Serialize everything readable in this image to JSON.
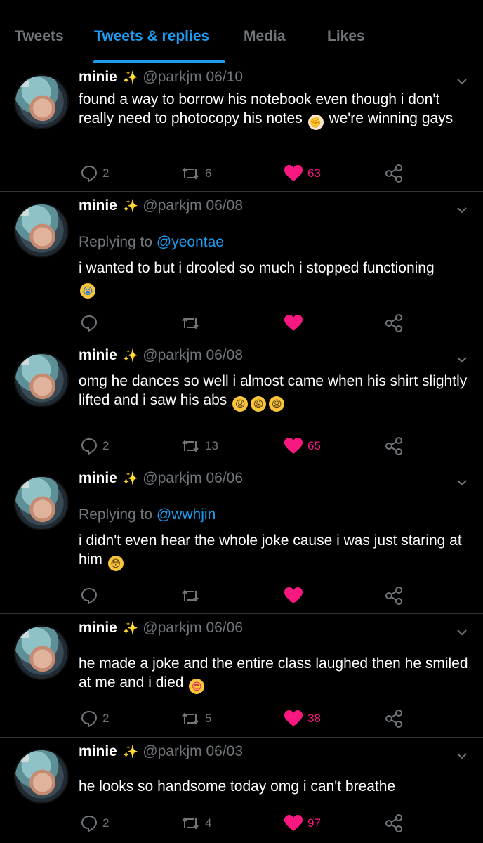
{
  "tabs": [
    {
      "label": "Tweets"
    },
    {
      "label": "Tweets & replies"
    },
    {
      "label": "Media"
    },
    {
      "label": "Likes"
    }
  ],
  "colors": {
    "accent": "#1d9bf0",
    "like": "#f91880",
    "muted": "#71767b",
    "sparkle": "#f5d23a"
  },
  "tweets": [
    {
      "name": "minie",
      "sparkle": "✨",
      "handle": "@parkjm 06/10",
      "replying_label": "",
      "replying_to": "",
      "text": "found a way to borrow his notebook even though i don't really need to photocopy his notes",
      "emoji": "✊",
      "text_after": "we're winning gays",
      "replies": "2",
      "retweets": "6",
      "likes": "63",
      "liked": true
    },
    {
      "name": "minie",
      "sparkle": "✨",
      "handle": "@parkjm 06/08",
      "replying_label": "Replying to",
      "replying_to": "@yeontae",
      "text": "i wanted to but i drooled so much i stopped functioning",
      "emoji": "😭",
      "text_after": "",
      "replies": "",
      "retweets": "",
      "likes": "",
      "liked": true
    },
    {
      "name": "minie",
      "sparkle": "✨",
      "handle": "@parkjm 06/08",
      "replying_label": "",
      "replying_to": "",
      "text": "omg he dances so well i almost came when his shirt slightly lifted and i saw his abs",
      "emoji": "😩😩😩",
      "text_after": "",
      "replies": "2",
      "retweets": "13",
      "likes": "65",
      "liked": true
    },
    {
      "name": "minie",
      "sparkle": "✨",
      "handle": "@parkjm 06/06",
      "replying_label": "Replying to",
      "replying_to": "@wwhjin",
      "text": "i didn't even hear the whole joke cause i was just staring at him",
      "emoji": "😳",
      "text_after": "",
      "replies": "",
      "retweets": "",
      "likes": "",
      "liked": true
    },
    {
      "name": "minie",
      "sparkle": "✨",
      "handle": "@parkjm 06/06",
      "replying_label": "",
      "replying_to": "",
      "text": "he made a joke and the entire class laughed then he smiled at me and i died",
      "emoji": "😍",
      "text_after": "",
      "replies": "2",
      "retweets": "5",
      "likes": "38",
      "liked": true
    },
    {
      "name": "minie",
      "sparkle": "✨",
      "handle": "@parkjm 06/03",
      "replying_label": "",
      "replying_to": "",
      "text": "he looks so handsome today omg i can't breathe",
      "emoji": "",
      "text_after": "",
      "replies": "2",
      "retweets": "4",
      "likes": "97",
      "liked": true
    }
  ]
}
